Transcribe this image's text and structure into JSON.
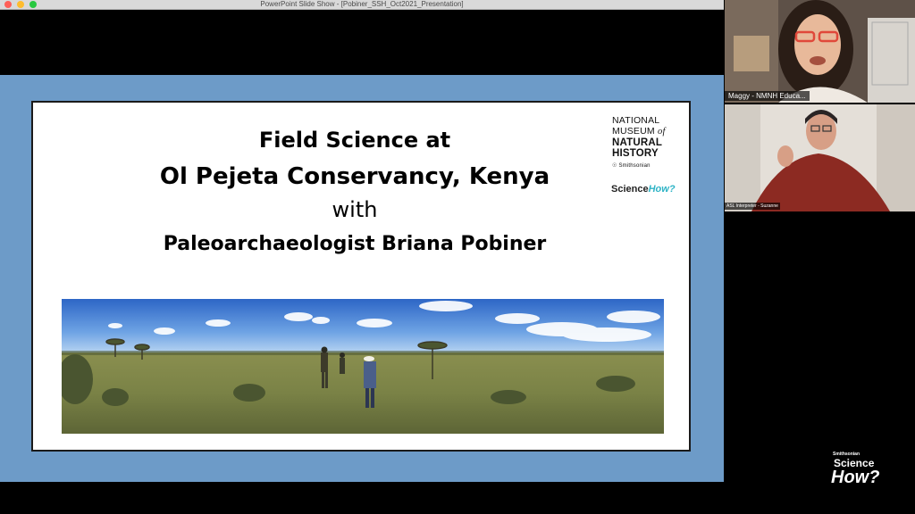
{
  "window": {
    "title": "PowerPoint Slide Show - [Pobiner_SSH_Oct2021_Presentation]"
  },
  "slide": {
    "title_line1": "Field Science at",
    "title_line2": "Ol Pejeta Conservancy, Kenya",
    "title_line3": "with",
    "title_line4": "Paleoarchaeologist Briana Pobiner",
    "logo_nmnh": {
      "line1": "NATIONAL",
      "line2": "MUSEUM",
      "line2_of": "of",
      "line3": "NATURAL",
      "line4": "HISTORY",
      "line5": "Smithsonian"
    },
    "logo_science_how": {
      "science": "Science",
      "how": "How?"
    },
    "photo": {
      "description_icon": "savanna-panorama-photo"
    }
  },
  "participants": [
    {
      "name": "Maggy - NMNH Educa..."
    },
    {
      "name": "ASL Interpreter - Suzanne"
    }
  ],
  "watermark": {
    "smithsonian": "Smithsonian",
    "science": "Science",
    "how": "How?"
  },
  "colors": {
    "slide_background": "#6d9bc8",
    "accent_teal": "#2fb4c6"
  }
}
